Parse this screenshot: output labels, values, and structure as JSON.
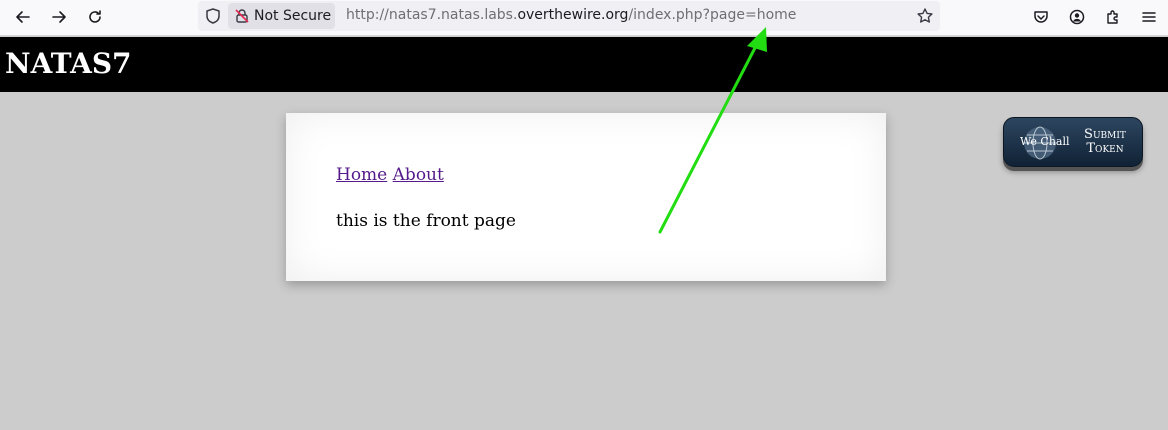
{
  "browser": {
    "security_label": "Not Secure",
    "url_prefix": "http://natas7.natas.labs.",
    "url_host": "overthewire.org",
    "url_path": "/index.php?page=home"
  },
  "page": {
    "title": "NATAS7",
    "nav": [
      {
        "label": "Home"
      },
      {
        "label": "About"
      }
    ],
    "body_text": "this is the front page"
  },
  "wechall": {
    "logo_text": "We Chall",
    "button_label_line1": "Submit",
    "button_label_line2": "Token"
  },
  "annotation": {
    "arrow_color": "#22dd11"
  }
}
